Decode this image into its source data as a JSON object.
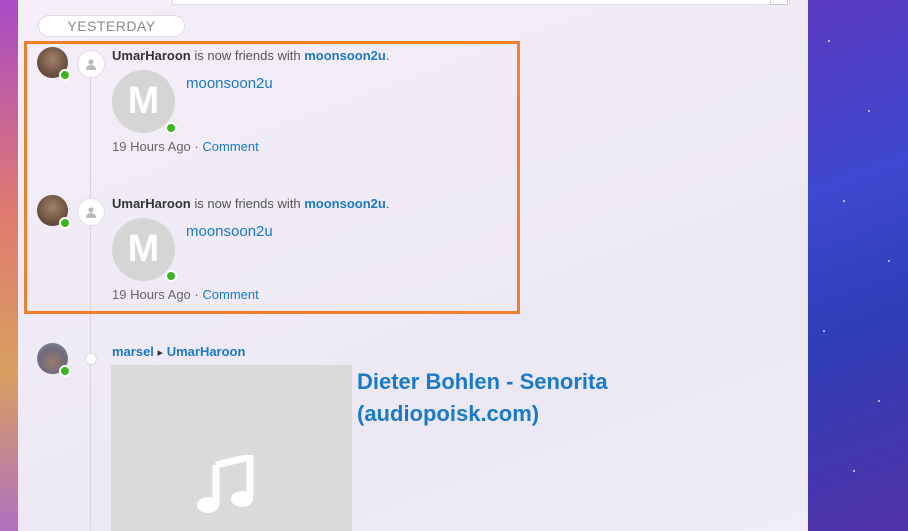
{
  "feed": {
    "day_label": "YESTERDAY",
    "items": [
      {
        "actor": "UmarHaroon",
        "action": "is now friends with",
        "target": "moonsoon2u",
        "period": ".",
        "friend_initial": "M",
        "friend_name": "moonsoon2u",
        "time": "19 Hours Ago",
        "separator": "·",
        "comment_label": "Comment"
      },
      {
        "actor": "UmarHaroon",
        "action": "is now friends with",
        "target": "moonsoon2u",
        "period": ".",
        "friend_initial": "M",
        "friend_name": "moonsoon2u",
        "time": "19 Hours Ago",
        "separator": "·",
        "comment_label": "Comment"
      }
    ],
    "post": {
      "author": "marsel",
      "arrow": "▸",
      "recipient": "UmarHaroon",
      "music_title": "Dieter Bohlen - Senorita (audiopoisk.com)",
      "icon": "music-note-icon"
    }
  },
  "colors": {
    "highlight": "#f07f2d",
    "link": "#1a7ac8",
    "online": "#3cb521"
  }
}
